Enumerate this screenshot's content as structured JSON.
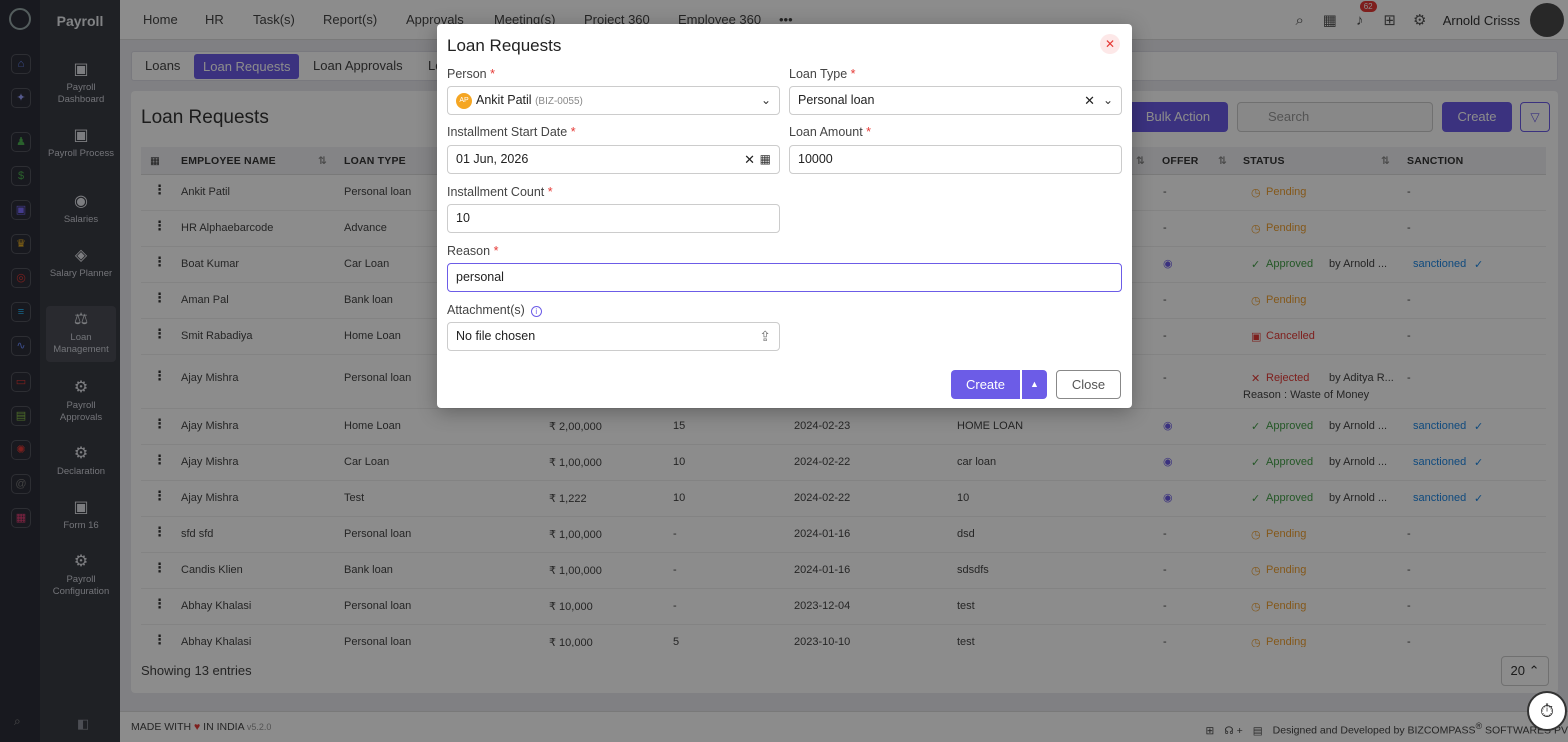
{
  "app": {
    "title": "Payroll"
  },
  "sidebar": {
    "items": [
      {
        "label": "Payroll Dashboard"
      },
      {
        "label": "Payroll Process"
      },
      {
        "label": "Salaries"
      },
      {
        "label": "Salary Planner"
      },
      {
        "label": "Loan Management"
      },
      {
        "label": "Payroll Approvals"
      },
      {
        "label": "Declaration"
      },
      {
        "label": "Form 16"
      },
      {
        "label": "Payroll Configuration"
      }
    ]
  },
  "topnav": {
    "items": [
      "Home",
      "HR",
      "Task(s)",
      "Report(s)",
      "Approvals",
      "Meeting(s)",
      "Project 360",
      "Employee 360"
    ],
    "notification_count": "62",
    "user_name": "Arnold Crisss"
  },
  "tabs": [
    "Loans",
    "Loan Requests",
    "Loan Approvals",
    "Lo"
  ],
  "page": {
    "title": "Loan Requests",
    "bulk_action": "Bulk Action",
    "search_placeholder": "Search",
    "create": "Create",
    "showing": "Showing 13 entries",
    "page_size": "20"
  },
  "table": {
    "headers": {
      "employee": "EMPLOYEE NAME",
      "loan_type": "LOAN TYPE",
      "offer": "OFFER",
      "status": "STATUS",
      "sanction": "SANCTION"
    },
    "rows": [
      {
        "name": "Ankit Patil",
        "type": "Personal loan",
        "amount": "",
        "count": "",
        "date": "",
        "reason": "",
        "offer": "-",
        "status": "Pending",
        "by": "",
        "sanction": "-"
      },
      {
        "name": "HR Alphaebarcode",
        "type": "Advance",
        "amount": "",
        "count": "",
        "date": "",
        "reason": "",
        "offer": "-",
        "status": "Pending",
        "by": "",
        "sanction": "-"
      },
      {
        "name": "Boat Kumar",
        "type": "Car Loan",
        "amount": "",
        "count": "",
        "date": "",
        "reason": "",
        "offer": "eye",
        "status": "Approved",
        "by": "by Arnold ...",
        "sanction": "sanctioned"
      },
      {
        "name": "Aman Pal",
        "type": "Bank loan",
        "amount": "",
        "count": "",
        "date": "",
        "reason": "",
        "offer": "-",
        "status": "Pending",
        "by": "",
        "sanction": "-"
      },
      {
        "name": "Smit Rabadiya",
        "type": "Home Loan",
        "amount": "",
        "count": "",
        "date": "",
        "reason": "",
        "offer": "-",
        "status": "Cancelled",
        "by": "",
        "sanction": "-"
      },
      {
        "name": "Ajay Mishra",
        "type": "Personal loan",
        "amount": "",
        "count": "",
        "date": "",
        "reason": "",
        "offer": "-",
        "status": "Rejected",
        "by": "by Aditya R...",
        "sanction": "-",
        "note": "Reason : Waste of Money"
      },
      {
        "name": "Ajay Mishra",
        "type": "Home Loan",
        "amount": "₹ 2,00,000",
        "count": "15",
        "date": "2024-02-23",
        "reason": "HOME LOAN",
        "offer": "eye",
        "status": "Approved",
        "by": "by Arnold ...",
        "sanction": "sanctioned"
      },
      {
        "name": "Ajay Mishra",
        "type": "Car Loan",
        "amount": "₹ 1,00,000",
        "count": "10",
        "date": "2024-02-22",
        "reason": "car loan",
        "offer": "eye",
        "status": "Approved",
        "by": "by Arnold ...",
        "sanction": "sanctioned"
      },
      {
        "name": "Ajay Mishra",
        "type": "Test",
        "amount": "₹ 1,222",
        "count": "10",
        "date": "2024-02-22",
        "reason": "10",
        "offer": "eye",
        "status": "Approved",
        "by": "by Arnold ...",
        "sanction": "sanctioned"
      },
      {
        "name": "sfd sfd",
        "type": "Personal loan",
        "amount": "₹ 1,00,000",
        "count": "-",
        "date": "2024-01-16",
        "reason": "dsd",
        "offer": "-",
        "status": "Pending",
        "by": "",
        "sanction": "-"
      },
      {
        "name": "Candis Klien",
        "type": "Bank loan",
        "amount": "₹ 1,00,000",
        "count": "-",
        "date": "2024-01-16",
        "reason": "sdsdfs",
        "offer": "-",
        "status": "Pending",
        "by": "",
        "sanction": "-"
      },
      {
        "name": "Abhay Khalasi",
        "type": "Personal loan",
        "amount": "₹ 10,000",
        "count": "-",
        "date": "2023-12-04",
        "reason": "test",
        "offer": "-",
        "status": "Pending",
        "by": "",
        "sanction": "-"
      },
      {
        "name": "Abhay Khalasi",
        "type": "Personal loan",
        "amount": "₹ 10,000",
        "count": "5",
        "date": "2023-10-10",
        "reason": "test",
        "offer": "-",
        "status": "Pending",
        "by": "",
        "sanction": "-"
      }
    ]
  },
  "footer": {
    "made_with": "MADE WITH",
    "in_india": "IN INDIA",
    "version": "v5.2.0",
    "designed": "Designed and Developed by",
    "company": "BIZCOMPASS",
    "company_suffix": "SOFTWARES PV"
  },
  "modal": {
    "title": "Loan Requests",
    "person_label": "Person",
    "person_initials": "AP",
    "person_name": "Ankit Patil",
    "person_code": "(BIZ-0055)",
    "loan_type_label": "Loan Type",
    "loan_type_value": "Personal loan",
    "start_label": "Installment Start Date",
    "start_value": "01 Jun, 2026",
    "amount_label": "Loan Amount",
    "amount_value": "10000",
    "count_label": "Installment Count",
    "count_value": "10",
    "reason_label": "Reason",
    "reason_value": "personal",
    "attachment_label": "Attachment(s)",
    "attachment_value": "No file chosen",
    "create": "Create",
    "close": "Close",
    "required_mark": "*"
  },
  "colors": {
    "accent": "#6c5ce7",
    "pending": "#f0a030",
    "approved": "#43a047",
    "danger": "#e53935"
  }
}
